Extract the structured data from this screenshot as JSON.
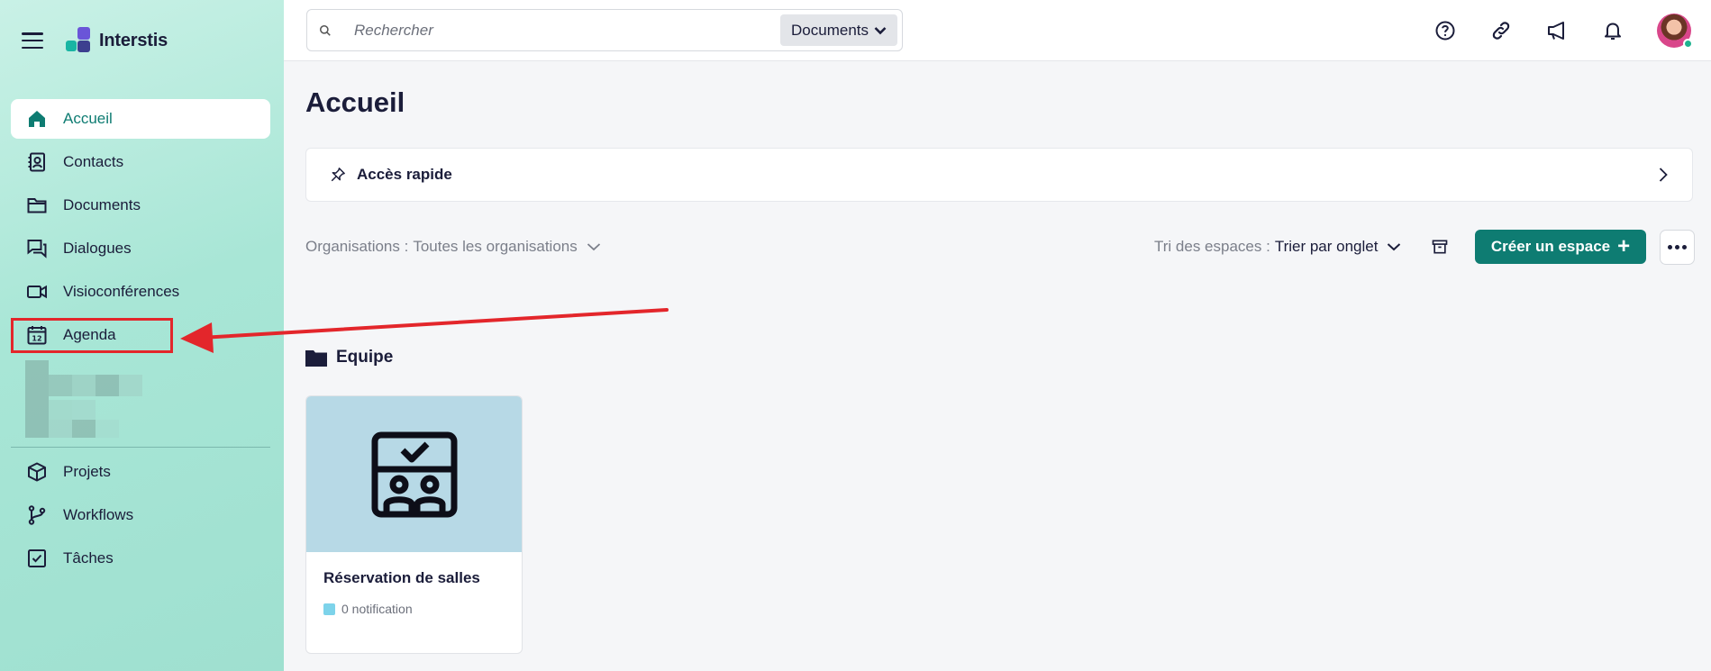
{
  "app": {
    "name": "Interstis"
  },
  "sidebar": {
    "items": [
      {
        "label": "Accueil",
        "icon": "home-icon",
        "active": true
      },
      {
        "label": "Contacts",
        "icon": "contacts-icon"
      },
      {
        "label": "Documents",
        "icon": "folder-icon"
      },
      {
        "label": "Dialogues",
        "icon": "chat-icon"
      },
      {
        "label": "Visioconférences",
        "icon": "video-icon"
      },
      {
        "label": "Agenda",
        "icon": "calendar-icon"
      }
    ],
    "secondary": [
      {
        "label": "Projets",
        "icon": "cube-icon"
      },
      {
        "label": "Workflows",
        "icon": "branch-icon"
      },
      {
        "label": "Tâches",
        "icon": "checkbox-icon"
      }
    ]
  },
  "topbar": {
    "search_placeholder": "Rechercher",
    "search_scope": "Documents",
    "icons": [
      "help-icon",
      "link-icon",
      "megaphone-icon",
      "bell-icon"
    ]
  },
  "main": {
    "title": "Accueil",
    "quick_access": "Accès rapide",
    "org_filter": {
      "label": "Organisations :",
      "value": "Toutes les organisations"
    },
    "sort_filter": {
      "label": "Tri des espaces :",
      "value": "Trier par onglet"
    },
    "create_button": "Créer un espace",
    "section": {
      "title": "Equipe",
      "cards": [
        {
          "title": "Réservation de salles",
          "notification": "0 notification"
        }
      ]
    }
  },
  "colors": {
    "accent": "#0e7c72",
    "highlight": "#e3262b",
    "card_image_bg": "#b7d9e6"
  }
}
